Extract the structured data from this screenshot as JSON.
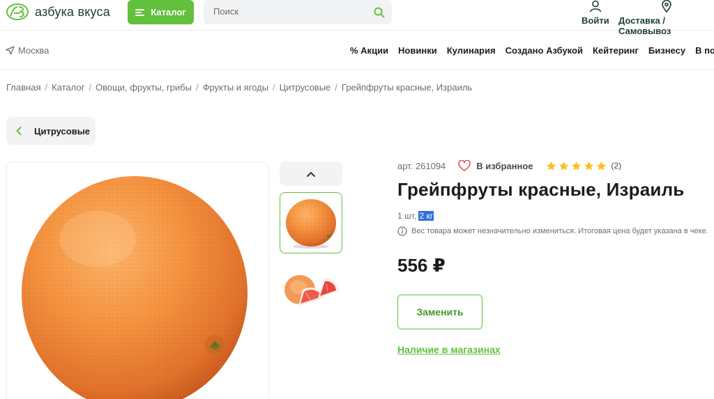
{
  "header": {
    "logo_text": "азбука вкуса",
    "catalog_label": "Каталог",
    "search_placeholder": "Поиск",
    "login_label": "Войти",
    "delivery_label": "Доставка / Самовывоз"
  },
  "nav": {
    "city": "Москва",
    "items": [
      "% Акции",
      "Новинки",
      "Кулинария",
      "Создано Азбукой",
      "Кейтеринг",
      "Бизнесу",
      "В подарок"
    ]
  },
  "breadcrumbs": [
    "Главная",
    "Каталог",
    "Овощи, фрукты, грибы",
    "Фрукты и ягоды",
    "Цитрусовые",
    "Грейпфруты красные, Израиль"
  ],
  "back_label": "Цитрусовые",
  "product": {
    "article": "арт. 261094",
    "favorite_label": "В избранное",
    "rating": 5,
    "reviews": "(2)",
    "title": "Грейпфруты красные, Израиль",
    "weight_prefix": "1 шт, ",
    "weight_highlight": "2 кг",
    "note": "Вес товара может незначительно измениться. Итоговая цена будет указана в чеке.",
    "price": "556 ₽",
    "replace_label": "Заменить",
    "stock_link": "Наличие в магазинах"
  },
  "colors": {
    "brand_green": "#62c03c",
    "star_yellow": "#f6c21c",
    "heart_red": "#e0455a",
    "fruit_orange": "#f08a3c"
  }
}
